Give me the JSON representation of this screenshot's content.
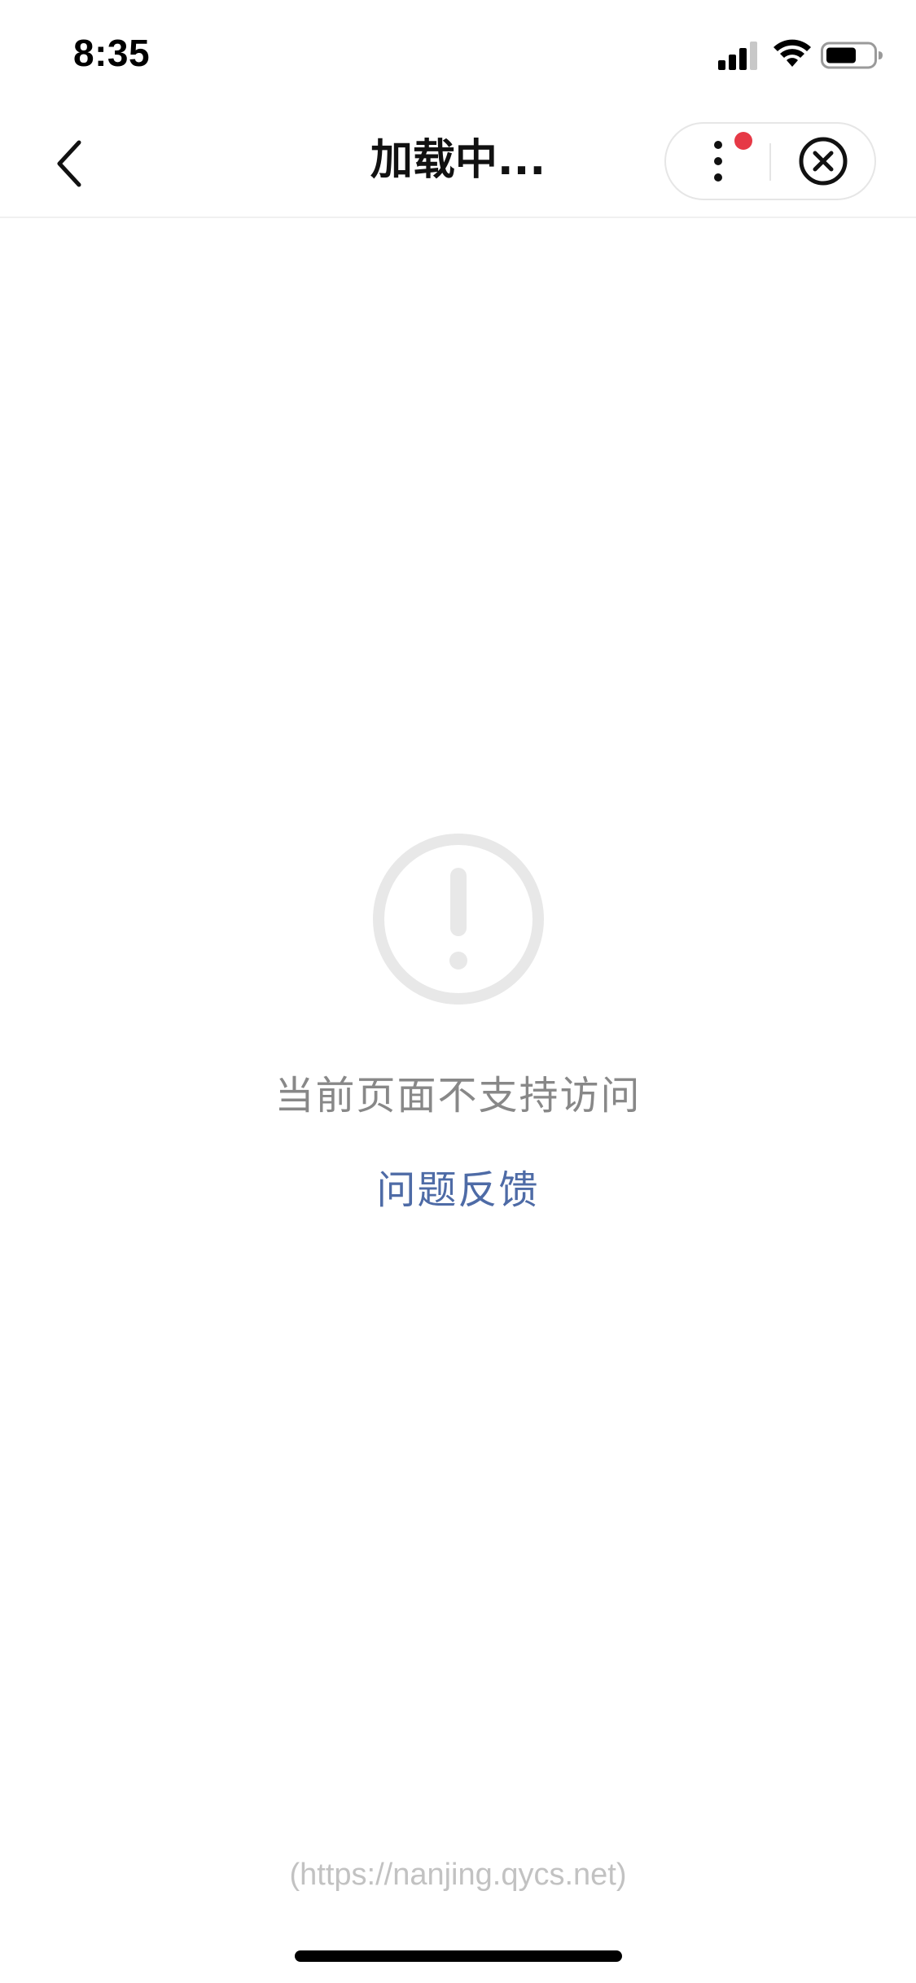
{
  "status_bar": {
    "time": "8:35",
    "icons": [
      "cellular-signal-icon",
      "wifi-icon",
      "battery-icon"
    ]
  },
  "nav": {
    "title": "加载中...",
    "back_icon": "chevron-left-icon",
    "more_icon": "more-vertical-icon",
    "close_icon": "close-circle-icon",
    "has_notification_dot": true,
    "notification_color": "#e63946"
  },
  "error": {
    "icon": "exclamation-circle-icon",
    "message": "当前页面不支持访问",
    "feedback_label": "问题反馈",
    "link_color": "#4e6ba6"
  },
  "footer": {
    "url": "(https://nanjing.qycs.net)"
  }
}
